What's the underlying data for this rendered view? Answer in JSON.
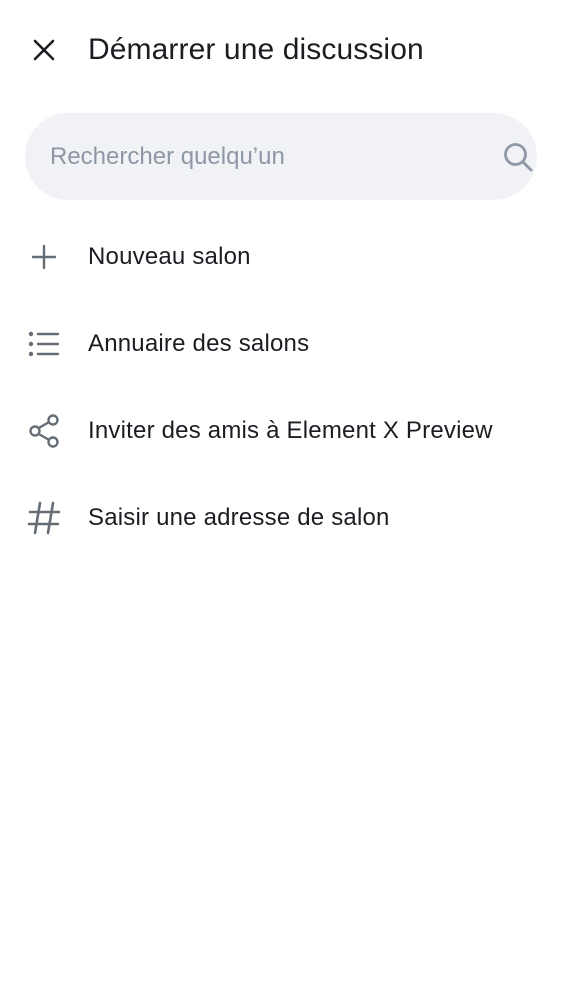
{
  "header": {
    "close_icon": "close-icon",
    "title": "Démarrer une discussion"
  },
  "search": {
    "placeholder": "Rechercher quelqu’un",
    "value": "",
    "icon": "search-icon"
  },
  "menu": {
    "items": [
      {
        "label": "Nouveau salon",
        "icon": "plus-icon"
      },
      {
        "label": "Annuaire des salons",
        "icon": "list-icon"
      },
      {
        "label": "Inviter des amis à Element X Preview",
        "icon": "share-icon"
      },
      {
        "label": "Saisir une adresse de salon",
        "icon": "hash-icon"
      }
    ]
  },
  "colors": {
    "background": "#ffffff",
    "text_primary": "#1b1d22",
    "icon": "#656d77",
    "search_bg": "#f0f2f5",
    "placeholder": "#8d97a5"
  }
}
